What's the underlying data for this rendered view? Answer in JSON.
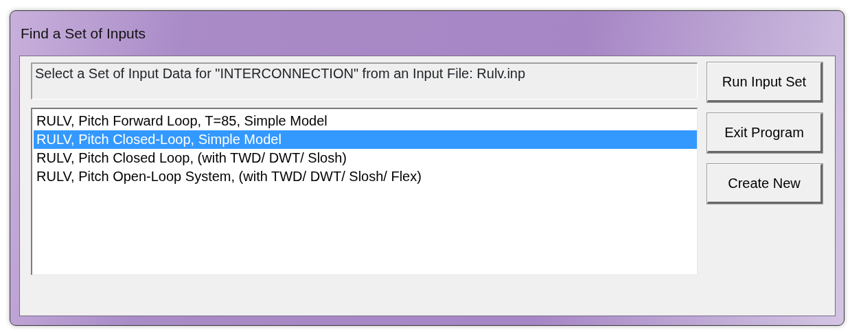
{
  "window": {
    "title": "Find a Set of Inputs"
  },
  "prompt": "Select a Set of Input Data for \"INTERCONNECTION\" from an Input File: Rulv.inp",
  "input_sets": [
    {
      "label": "RULV, Pitch Forward Loop, T=85, Simple Model",
      "selected": false
    },
    {
      "label": "RULV, Pitch Closed-Loop, Simple Model",
      "selected": true
    },
    {
      "label": "RULV, Pitch Closed Loop, (with TWD/ DWT/ Slosh)",
      "selected": false
    },
    {
      "label": "RULV, Pitch Open-Loop System, (with TWD/ DWT/ Slosh/ Flex)",
      "selected": false
    }
  ],
  "buttons": [
    "Run Input Set",
    "Exit Program",
    "Create New"
  ]
}
